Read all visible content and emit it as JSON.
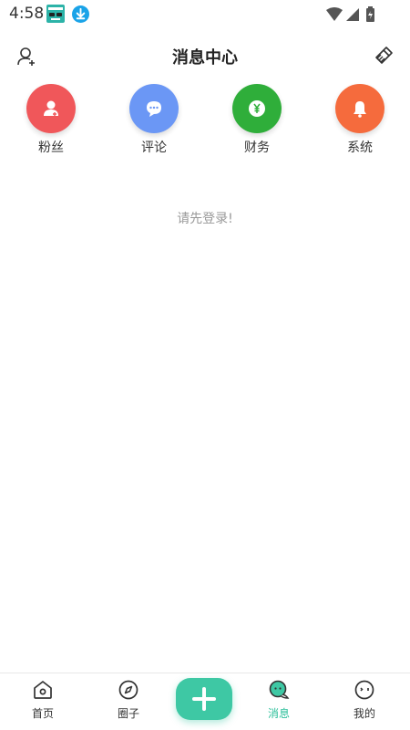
{
  "status_bar": {
    "time": "4:58"
  },
  "header": {
    "title": "消息中心",
    "left_icon": "add-user-icon",
    "right_icon": "broom-clear-icon"
  },
  "categories": [
    {
      "label": "粉丝",
      "icon": "user-icon",
      "color": "#f0575a"
    },
    {
      "label": "评论",
      "icon": "comment-icon",
      "color": "#6b97f5"
    },
    {
      "label": "财务",
      "icon": "yuan-icon",
      "color": "#2fae3a"
    },
    {
      "label": "系统",
      "icon": "bell-icon",
      "color": "#f56b3d"
    }
  ],
  "main": {
    "login_hint": "请先登录!"
  },
  "bottom_nav": {
    "items": [
      {
        "label": "首页",
        "icon": "home-icon"
      },
      {
        "label": "圈子",
        "icon": "compass-icon"
      },
      {
        "label": "消息",
        "icon": "message-icon",
        "active": true
      },
      {
        "label": "我的",
        "icon": "profile-face-icon"
      }
    ],
    "fab_icon": "plus-icon",
    "active_color": "#2bbf9a"
  }
}
